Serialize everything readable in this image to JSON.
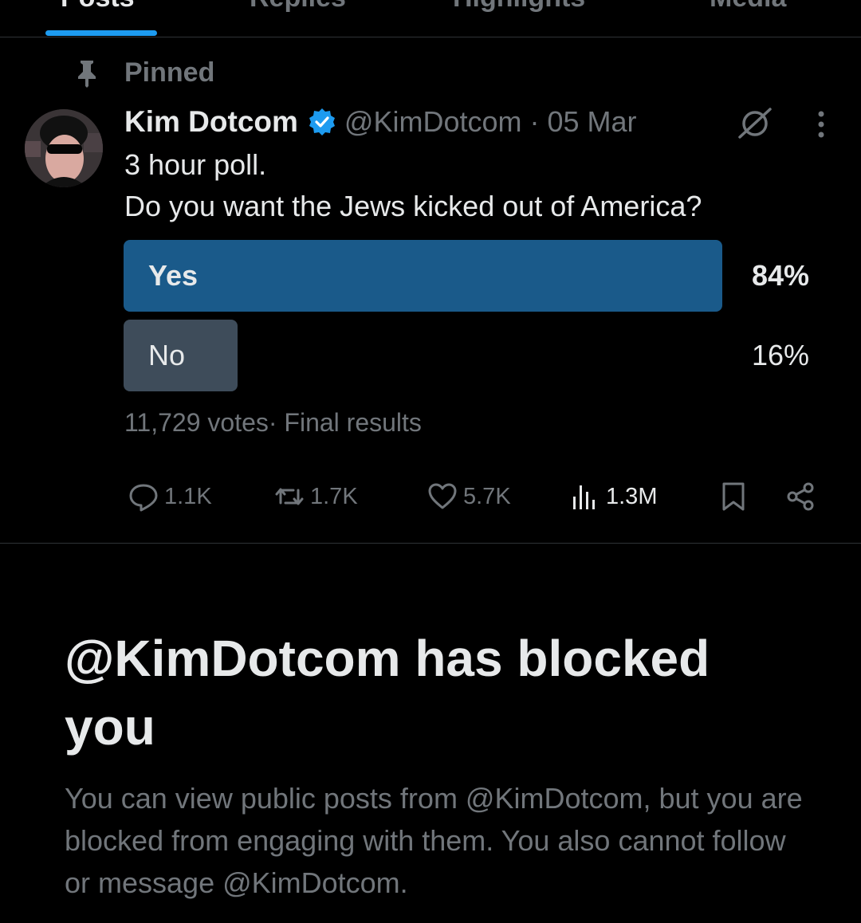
{
  "tabs": [
    {
      "label": "Posts",
      "active": true
    },
    {
      "label": "Replies",
      "active": false
    },
    {
      "label": "Highlights",
      "active": false
    },
    {
      "label": "Media",
      "active": false
    }
  ],
  "pinned_label": "Pinned",
  "post": {
    "author_name": "Kim Dotcom",
    "handle": "@KimDotcom",
    "separator": "·",
    "date": "05 Mar",
    "line1": "3 hour poll.",
    "line2": "Do you want the Jews kicked out of America?"
  },
  "poll": {
    "options": [
      {
        "label": "Yes",
        "percent_text": "84%",
        "percent": 84
      },
      {
        "label": "No",
        "percent_text": "16%",
        "percent": 16
      }
    ],
    "meta": "11,729 votes· Final results"
  },
  "actions": {
    "replies": "1.1K",
    "reposts": "1.7K",
    "likes": "5.7K",
    "views": "1.3M"
  },
  "blocked": {
    "title": "@KimDotcom has blocked you",
    "description": "You can view public posts from @KimDotcom, but you are blocked from engaging with them. You also cannot follow or message @KimDotcom."
  },
  "colors": {
    "accent": "#1d9bf0",
    "poll_winner": "#1a5a8a",
    "poll_loser": "#3e4c5a",
    "secondary_text": "#71767b"
  }
}
